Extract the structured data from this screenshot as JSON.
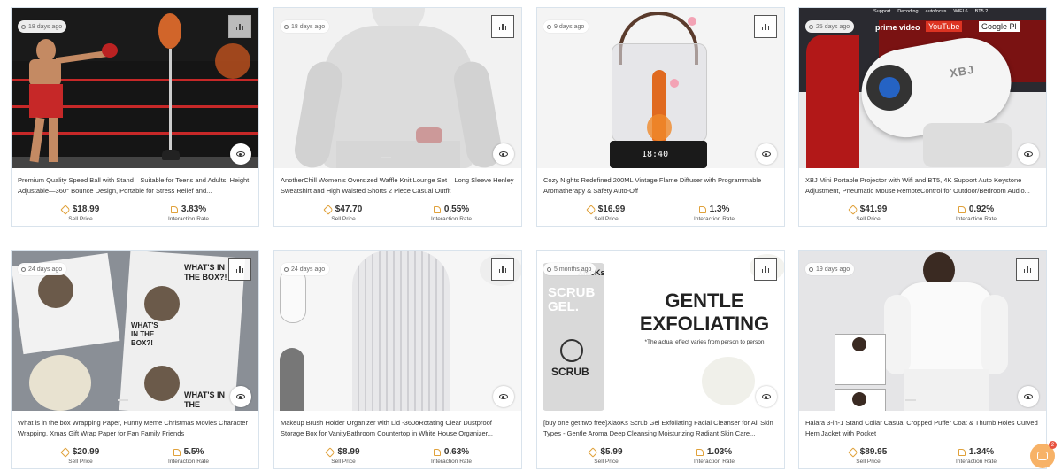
{
  "products": [
    {
      "age": "18 days ago",
      "title": "Premium Quality Speed Ball with Stand—Suitable for Teens and Adults, Height Adjustable—360° Bounce Design, Portable for Stress Relief and...",
      "price": "$18.99",
      "price_label": "Sell Price",
      "rate": "3.83%",
      "rate_label": "Interaction Rate"
    },
    {
      "age": "18 days ago",
      "title": "AnotherChill Women's Oversized Waffle Knit Lounge Set – Long Sleeve Henley Sweatshirt and High Waisted Shorts 2 Piece Casual Outfit",
      "price": "$47.70",
      "price_label": "Sell Price",
      "rate": "0.55%",
      "rate_label": "Interaction Rate"
    },
    {
      "age": "9 days ago",
      "title": "Cozy Nights Redefined 200ML Vintage Flame Diffuser with Programmable Aromatherapy & Safety Auto-Off",
      "price": "$16.99",
      "price_label": "Sell Price",
      "rate": "1.3%",
      "rate_label": "Interaction Rate"
    },
    {
      "age": "25 days ago",
      "title": "XBJ Mini Portable Projector with Wifi and BT5, 4K Support Auto Keystone Adjustment, Pneumatic Mouse RemoteControl for Outdoor/Bedroom Audio...",
      "price": "$41.99",
      "price_label": "Sell Price",
      "rate": "0.92%",
      "rate_label": "Interaction Rate"
    },
    {
      "age": "24 days ago",
      "title": "What is in the box Wrapping Paper, Funny Meme Christmas Movies Character Wrapping, Xmas Gift Wrap Paper for Fan Family Friends",
      "price": "$20.99",
      "price_label": "Sell Price",
      "rate": "5.5%",
      "rate_label": "Interaction Rate"
    },
    {
      "age": "24 days ago",
      "title": "Makeup Brush Holder Organizer with Lid -360oRotating Clear Dustproof Storage Box for VanityBathroom Countertop in White House Organizer...",
      "price": "$8.99",
      "price_label": "Sell Price",
      "rate": "0.63%",
      "rate_label": "Interaction Rate"
    },
    {
      "age": "5 months ago",
      "title": "[buy one get two free]XiaoKs Scrub Gel Exfoliating Facial Cleanser for All Skin Types - Gentle Aroma Deep Cleansing Moisturizing Radiant Skin Care...",
      "price": "$5.99",
      "price_label": "Sell Price",
      "rate": "1.03%",
      "rate_label": "Interaction Rate"
    },
    {
      "age": "19 days ago",
      "title": "Halara 3-in-1 Stand Collar Casual Cropped Puffer Coat & Thumb Holes Curved Hem Jacket with Pocket",
      "price": "$89.95",
      "price_label": "Sell Price",
      "rate": "1.34%",
      "rate_label": "Interaction Rate"
    }
  ],
  "image_text": {
    "projector_brand": "XBJ",
    "projector_apps": [
      "prime video",
      "YouTube",
      "Google Pl"
    ],
    "projector_menu": [
      "Support",
      "Decoding",
      "autofocus",
      "WIFI 6",
      "BT5.2"
    ],
    "diffuser_clock": "18:40",
    "wrap_text": [
      "WHAT'S IN THE BOX?!",
      "WHAT'S IN THE BOX?!",
      "WHAT'S IN THE"
    ],
    "scrub_brand": "XiaoKs",
    "scrub_tube": "SCRUB GEL.",
    "scrub_tube_bottom": "SCRUB",
    "scrub_headline": "GENTLE EXFOLIATING",
    "scrub_sub": "*The actual effect varies from person to person"
  },
  "chat": {
    "badge": "2"
  },
  "colors": {
    "accent": "#e0a13a",
    "border": "#d9e3ec",
    "chat": "#f7b267"
  }
}
